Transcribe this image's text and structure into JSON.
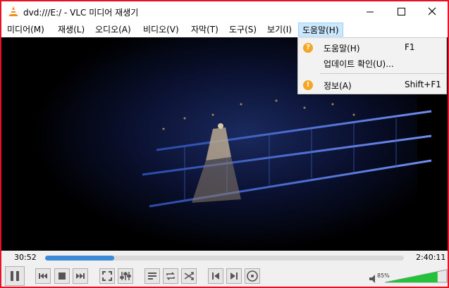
{
  "window": {
    "title": "dvd:///E:/ - VLC 미디어 재생기",
    "accent": "#e81123"
  },
  "menubar": {
    "items": [
      {
        "label": "미디어(M)"
      },
      {
        "label": "재생(L)"
      },
      {
        "label": "오디오(A)"
      },
      {
        "label": "비디오(V)"
      },
      {
        "label": "자막(T)"
      },
      {
        "label": "도구(S)"
      },
      {
        "label": "보기(I)"
      },
      {
        "label": "도움말(H)"
      }
    ]
  },
  "help_menu": {
    "items": [
      {
        "label": "도움말(H)",
        "shortcut": "F1",
        "icon": "help-icon"
      },
      {
        "label": "업데이트 확인(U)...",
        "shortcut": ""
      },
      {
        "label": "정보(A)",
        "shortcut": "Shift+F1",
        "icon": "info-icon"
      }
    ]
  },
  "playback": {
    "elapsed": "30:52",
    "total": "2:40:11",
    "progress_fraction": 0.193,
    "volume": "85%",
    "volume_fraction": 0.85
  }
}
